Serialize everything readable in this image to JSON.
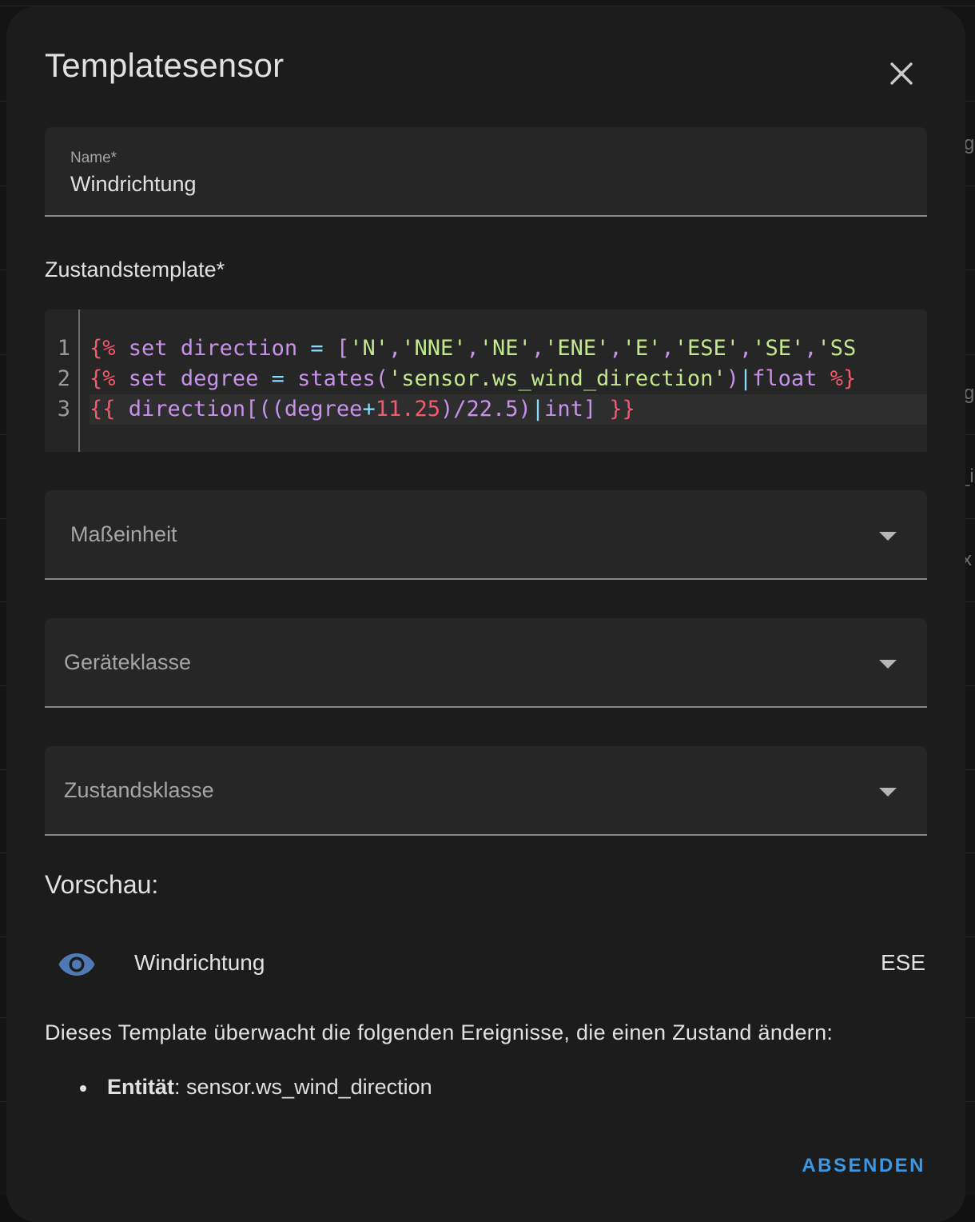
{
  "background": {
    "peek_texts": [
      "g",
      "g",
      "_i",
      "x"
    ]
  },
  "dialog": {
    "title": "Templatesensor",
    "close_icon": "close-icon"
  },
  "name_field": {
    "label": "Name*",
    "value": "Windrichtung"
  },
  "template": {
    "label": "Zustandstemplate*",
    "line_numbers": [
      "1",
      "2",
      "3"
    ],
    "lines": [
      "{% set direction = ['N','NNE','NE','ENE','E','ESE','SE','SS",
      "{% set degree = states('sensor.ws_wind_direction')|float %}",
      "{{ direction[((degree+11.25)/22.5)|int] }}"
    ]
  },
  "selects": {
    "unit": {
      "label": "Maßeinheit"
    },
    "device_class": {
      "label": "Geräteklasse"
    },
    "state_class": {
      "label": "Zustandsklasse"
    }
  },
  "preview": {
    "title": "Vorschau:",
    "icon": "eye-icon",
    "entity_name": "Windrichtung",
    "state": "ESE"
  },
  "listeners": {
    "info": "Dieses Template überwacht die folgenden Ereignisse, die einen Zustand ändern:",
    "items": [
      {
        "key": "Entität",
        "value": ": sensor.ws_wind_direction"
      }
    ]
  },
  "actions": {
    "submit_label": "ABSENDEN"
  },
  "colors": {
    "accent": "#3d98e4",
    "icon_blue": "#4f79b5",
    "code_red": "#f25a6d",
    "code_purple": "#c792ea",
    "code_green": "#c3e88d",
    "code_cyan": "#89ddff"
  }
}
